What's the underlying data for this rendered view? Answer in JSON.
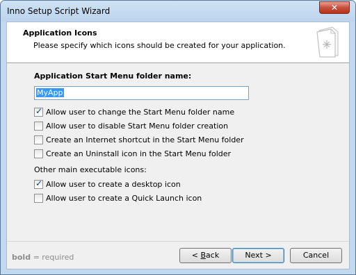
{
  "window": {
    "title": "Inno Setup Script Wizard"
  },
  "header": {
    "title": "Application Icons",
    "subtitle": "Please specify which icons should be created for your application."
  },
  "form": {
    "folder_label": "Application Start Menu folder name:",
    "folder_value": "MyApp",
    "checkboxes": [
      {
        "label": "Allow user to change the Start Menu folder name",
        "checked": true
      },
      {
        "label": "Allow user to disable Start Menu folder creation",
        "checked": false
      },
      {
        "label": "Create an Internet shortcut in the Start Menu folder",
        "checked": false
      },
      {
        "label": "Create an Uninstall icon in the Start Menu folder",
        "checked": false
      }
    ],
    "other_label": "Other main executable icons:",
    "other_checkboxes": [
      {
        "label": "Allow user to create a desktop icon",
        "checked": true
      },
      {
        "label": "Allow user to create a Quick Launch icon",
        "checked": false
      }
    ]
  },
  "footer": {
    "legend_bold": "bold",
    "legend_rest": " = required",
    "back_accel": "B",
    "back_rest": "ack",
    "back_prefix": "< ",
    "next_label": "Next >",
    "cancel_label": "Cancel"
  }
}
